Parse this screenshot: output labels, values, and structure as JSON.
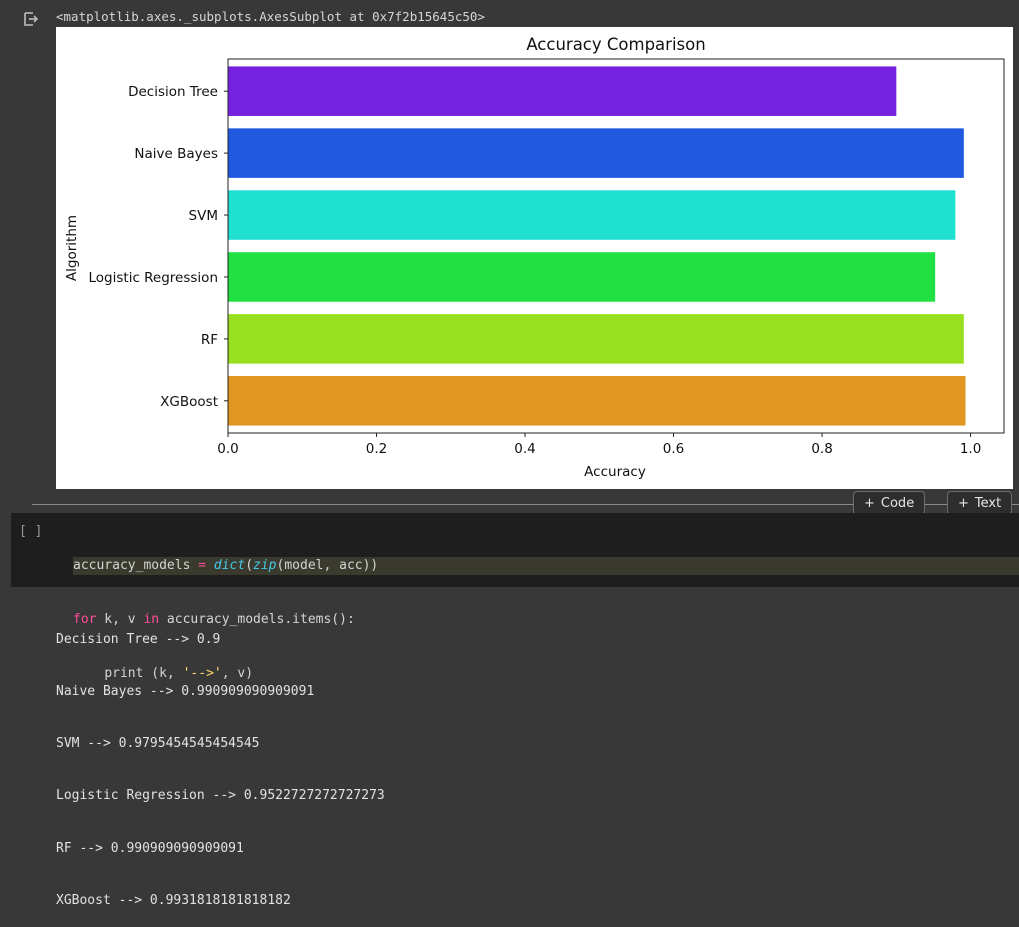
{
  "output_repr": "<matplotlib.axes._subplots.AxesSubplot at 0x7f2b15645c50>",
  "chart_data": {
    "type": "bar",
    "orientation": "horizontal",
    "title": "Accuracy Comparison",
    "xlabel": "Accuracy",
    "ylabel": "Algorithm",
    "categories": [
      "Decision Tree",
      "Naive Bayes",
      "SVM",
      "Logistic Regression",
      "RF",
      "XGBoost"
    ],
    "values": [
      0.9,
      0.990909090909091,
      0.9795454545454545,
      0.9522727272727273,
      0.990909090909091,
      0.9931818181818182
    ],
    "colors": [
      "#7620E0",
      "#2059E0",
      "#20E0D2",
      "#20E042",
      "#98E020",
      "#E09620"
    ],
    "xlim": [
      0,
      1.045
    ],
    "xticks": [
      0.0,
      0.2,
      0.4,
      0.6,
      0.8,
      1.0
    ],
    "xtick_labels": [
      "0.0",
      "0.2",
      "0.4",
      "0.6",
      "0.8",
      "1.0"
    ],
    "grid": false,
    "legend": "none"
  },
  "toolbar": {
    "code_label": "Code",
    "text_label": "Text"
  },
  "cell": {
    "run_indicator": "[ ]",
    "line1": {
      "var": "accuracy_models",
      "eq": " = ",
      "fn": "dict",
      "open": "(",
      "fn2": "zip",
      "args": "(model, acc))"
    },
    "line2": {
      "kw_for": "for",
      "mid": " k, v ",
      "kw_in": "in",
      "rest": " accuracy_models.items():"
    },
    "line3": {
      "indent": "    ",
      "call": "print (k, ",
      "str": "'-->'",
      "end": ", v)"
    }
  },
  "output": {
    "lines": [
      "Decision Tree --> 0.9",
      "Naive Bayes --> 0.990909090909091",
      "SVM --> 0.9795454545454545",
      "Logistic Regression --> 0.9522727272727273",
      "RF --> 0.990909090909091",
      "XGBoost --> 0.9931818181818182"
    ]
  }
}
